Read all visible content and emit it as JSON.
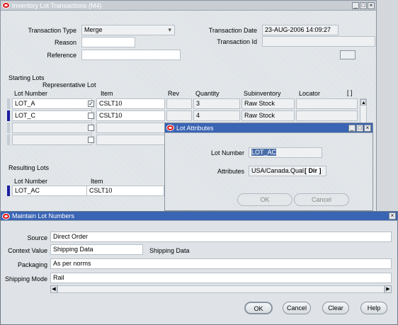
{
  "main_window": {
    "title": "Inventory Lot Transactions (M4)",
    "transaction_type_label": "Transaction Type",
    "transaction_type_value": "Merge",
    "reason_label": "Reason",
    "reason_value": "",
    "reference_label": "Reference",
    "reference_value": "",
    "transaction_date_label": "Transaction Date",
    "transaction_date_value": "23-AUG-2006 14:09:27",
    "transaction_id_label": "Transaction Id",
    "transaction_id_value": "",
    "starting_lots_label": "Starting Lots",
    "representative_lot_label": "Representative Lot",
    "columns": {
      "lot_number": "Lot Number",
      "item": "Item",
      "rev": "Rev",
      "quantity": "Quantity",
      "subinventory": "Subinventory",
      "locator": "Locator"
    },
    "starting_rows": [
      {
        "lot": "LOT_A",
        "item": "CSLT10",
        "rev": "",
        "qty": "3",
        "subinv": "Raw Stock",
        "locator": "",
        "checked": "✓"
      },
      {
        "lot": "LOT_C",
        "item": "CSLT10",
        "rev": "",
        "qty": "4",
        "subinv": "Raw Stock",
        "locator": "",
        "checked": ""
      },
      {
        "lot": "",
        "item": "",
        "rev": "",
        "qty": "",
        "subinv": "",
        "locator": "",
        "checked": ""
      },
      {
        "lot": "",
        "item": "",
        "rev": "",
        "qty": "",
        "subinv": "",
        "locator": "",
        "checked": ""
      }
    ],
    "resulting_lots_label": "Resulting Lots",
    "result_columns": {
      "lot_number": "Lot Number",
      "item": "Item"
    },
    "result_row": {
      "lot": "LOT_AC",
      "item": "CSLT10"
    }
  },
  "lot_attributes_dialog": {
    "title": "Lot Attributes",
    "lot_number_label": "Lot Number",
    "lot_number_value": "LOT_AC",
    "attributes_label": "Attributes",
    "attributes_value": "USA/Canada.Qual",
    "dir_button": "[ Dir ]",
    "ok_button": "OK",
    "cancel_button": "Cancel"
  },
  "maintain_dialog": {
    "title": "Maintain Lot Numbers",
    "source_label": "Source",
    "source_value": "Direct Order",
    "context_value_label": "Context Value",
    "context_value": "Shipping Data",
    "context_desc": "Shipping Data",
    "packaging_label": "Packaging",
    "packaging_value": "As per norms",
    "shipping_mode_label": "Shipping Mode",
    "shipping_mode_value": "Rail",
    "ok_button": "OK",
    "cancel_button": "Cancel",
    "clear_button": "Clear",
    "help_button": "Help"
  }
}
